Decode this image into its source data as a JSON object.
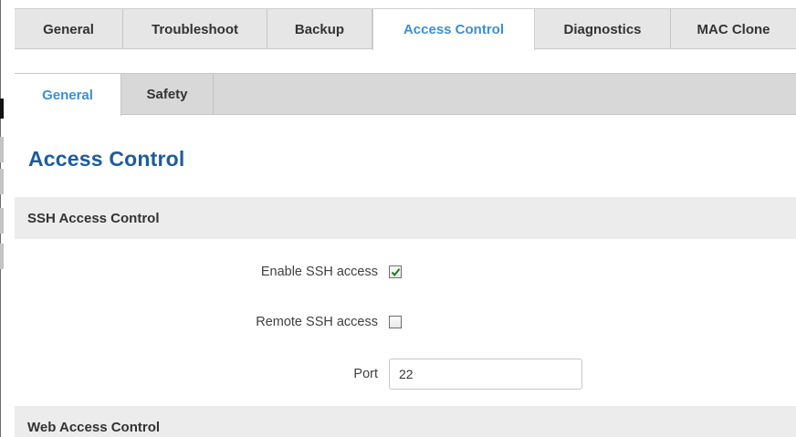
{
  "top_tabs": [
    {
      "label": "General"
    },
    {
      "label": "Troubleshoot"
    },
    {
      "label": "Backup"
    },
    {
      "label": "Access Control",
      "active": true
    },
    {
      "label": "Diagnostics"
    },
    {
      "label": "MAC Clone"
    }
  ],
  "sub_tabs": [
    {
      "label": "General",
      "active": true
    },
    {
      "label": "Safety"
    }
  ],
  "page": {
    "title": "Access Control"
  },
  "ssh_section": {
    "header": "SSH Access Control",
    "enable_ssh": {
      "label": "Enable SSH access",
      "checked": true
    },
    "remote_ssh": {
      "label": "Remote SSH access",
      "checked": false
    },
    "port": {
      "label": "Port",
      "value": "22"
    }
  },
  "web_section": {
    "header": "Web Access Control"
  },
  "colors": {
    "active_tab_text": "#3b8fd6",
    "title": "#1c5c9c",
    "check_mark": "#1f7a1f"
  },
  "icons": {
    "checkbox_checked": "checkmark-icon"
  }
}
